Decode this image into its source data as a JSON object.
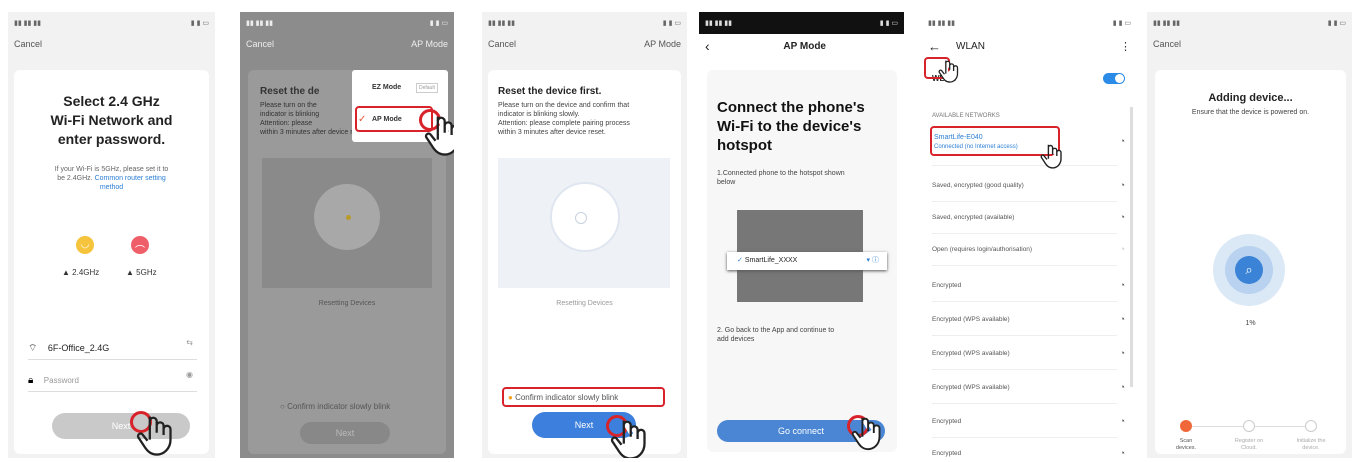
{
  "screen1": {
    "cancel": "Cancel",
    "title_l1": "Select 2.4 GHz",
    "title_l2": "Wi-Fi Network and",
    "title_l3": "enter password.",
    "info_l1": "If your Wi-Fi is 5GHz, please set it to",
    "info_l2": "be 2.4GHz.",
    "link_l1": "Common router setting",
    "link_l2": "method",
    "band24": "2.4GHz",
    "band5": "5GHz",
    "ssid": "6F-Office_2.4G",
    "password_placeholder": "Password",
    "next": "Next"
  },
  "screen2": {
    "cancel": "Cancel",
    "mode": "AP Mode",
    "title": "Reset the de",
    "text": [
      "Please turn on the",
      "indicator is blinking",
      "Attention: please",
      "within 3 minutes after device reset."
    ],
    "menu_ez": "EZ Mode",
    "menu_default": "Default",
    "menu_ap": "AP Mode",
    "resetting": "Resetting Devices",
    "confirm": "Confirm indicator slowly blink",
    "next": "Next"
  },
  "screen3": {
    "cancel": "Cancel",
    "mode": "AP Mode",
    "title": "Reset the device first.",
    "text": [
      "Please turn on the device and confirm that",
      "indicator is blinking slowly.",
      "Attention: please complete pairing process",
      "within 3 minutes after device reset."
    ],
    "resetting": "Resetting Devices",
    "confirm": "Confirm indicator slowly blink",
    "next": "Next"
  },
  "screen4": {
    "title": "AP Mode",
    "heading_l1": "Connect the phone's",
    "heading_l2": "Wi-Fi to the device's",
    "heading_l3": "hotspot",
    "step1_l1": "1.Connected phone to the hotspot shown",
    "step1_l2": "below",
    "ssid": "SmartLife_XXXX",
    "step2_l1": "2. Go back to the App and continue to",
    "step2_l2": "add devices",
    "go": "Go connect"
  },
  "screen5": {
    "title": "WLAN",
    "wlan": "WLAN",
    "available": "AVAILABLE NETWORKS",
    "hotspot": "SmartLife-E040",
    "hotspot_status": "Connected (no Internet access)",
    "networks": [
      "Saved, encrypted (good quality)",
      "Saved, encrypted (available)",
      "Open (requires login/authorisation)",
      "Encrypted",
      "Encrypted (WPS available)",
      "Encrypted (WPS available)",
      "Encrypted (WPS available)",
      "Encrypted",
      "Encrypted"
    ]
  },
  "screen6": {
    "cancel": "Cancel",
    "title": "Adding device...",
    "subtitle": "Ensure that the device is powered on.",
    "percent": "1%",
    "step1_l1": "Scan",
    "step1_l2": "devices.",
    "step2_l1": "Register on",
    "step2_l2": "Cloud.",
    "step3_l1": "Initialize the",
    "step3_l2": "device."
  }
}
